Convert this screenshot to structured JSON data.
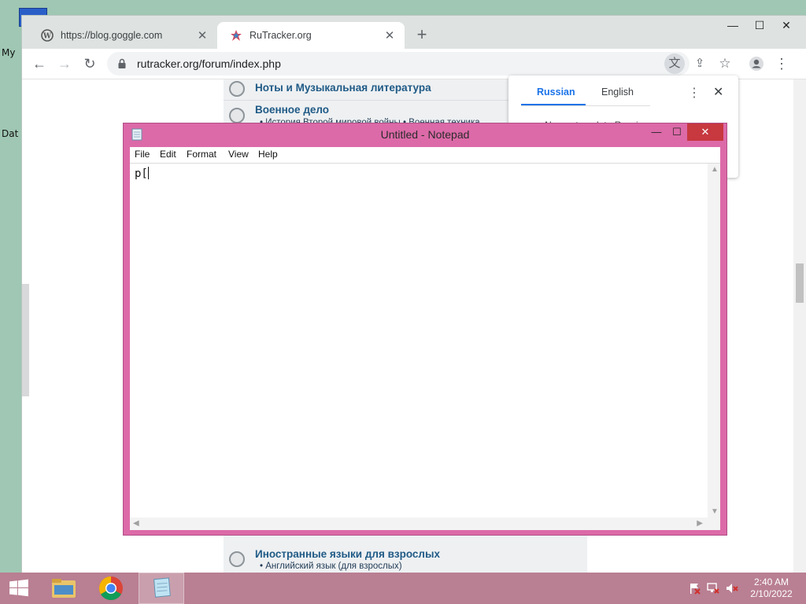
{
  "desktop": {
    "labels": [
      "My",
      "Dat"
    ]
  },
  "browser": {
    "tabs": [
      {
        "title": "https://blog.goggle.com",
        "active": false
      },
      {
        "title": "RuTracker.org",
        "active": true
      }
    ],
    "new_tab": "+",
    "url": "rutracker.org/forum/index.php",
    "window_controls": {
      "minimize": "—",
      "maximize": "☐",
      "close": "✕"
    }
  },
  "page": {
    "forums": [
      {
        "title": "Ноты и Музыкальная литература",
        "sub": ""
      },
      {
        "title": "Военное дело",
        "sub": "• История Второй мировой войны • Военная техника"
      },
      {
        "title": "Иностранные языки для взрослых",
        "sub": "• Английский язык (для взрослых)"
      }
    ]
  },
  "translate_popup": {
    "tabs": [
      "Russian",
      "English"
    ],
    "selected": "Russian",
    "option_label": "Always translate Russian"
  },
  "notepad": {
    "title": "Untitled - Notepad",
    "menu": [
      "File",
      "Edit",
      "Format",
      "View",
      "Help"
    ],
    "text": "p["
  },
  "taskbar": {
    "clock_time": "2:40 AM",
    "clock_date": "2/10/2022"
  }
}
